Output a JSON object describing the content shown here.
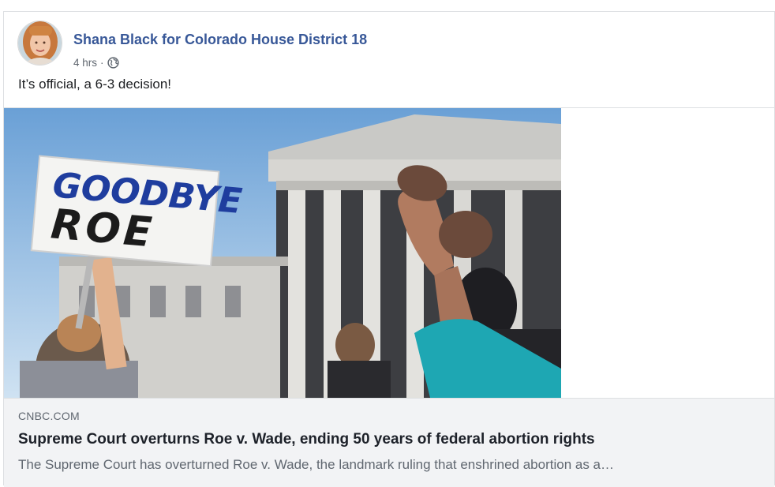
{
  "post": {
    "author": "Shana Black for Colorado House District 18",
    "time": "4 hrs",
    "separator": "·",
    "privacy_icon": "globe-icon",
    "text": "It’s official, a 6-3 decision!"
  },
  "attachment": {
    "photo_sign_line1": "GOODBYE",
    "photo_sign_line2": "ROE",
    "domain": "CNBC.COM",
    "headline": "Supreme Court overturns Roe v. Wade, ending 50 years of federal abortion rights",
    "description": "The Supreme Court has overturned Roe v. Wade, the landmark ruling that enshrined abortion as a…"
  },
  "colors": {
    "link_blue": "#385898",
    "meta_gray": "#606770",
    "card_bg": "#f2f3f5",
    "border": "#dddfe2"
  }
}
